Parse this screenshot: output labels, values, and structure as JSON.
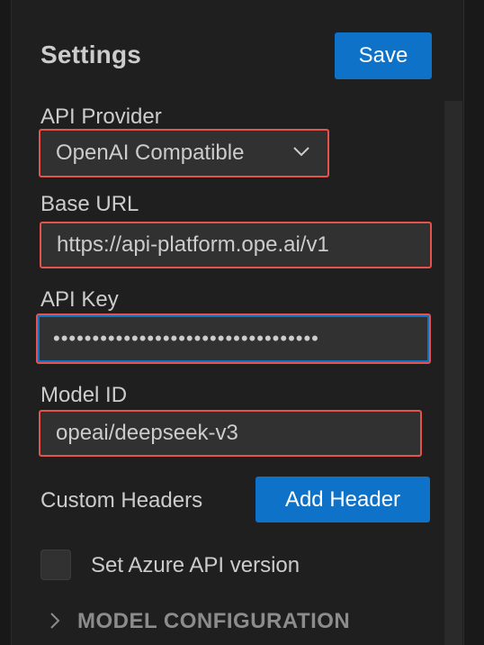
{
  "settings": {
    "title": "Settings",
    "save_label": "Save"
  },
  "api_provider": {
    "label": "API Provider",
    "selected": "OpenAI Compatible"
  },
  "base_url": {
    "label": "Base URL",
    "value": "https://api-platform.ope.ai/v1"
  },
  "api_key": {
    "label": "API Key",
    "value": "••••••••••••••••••••••••••••••••••"
  },
  "model_id": {
    "label": "Model ID",
    "value": "opeai/deepseek-v3"
  },
  "custom_headers": {
    "label": "Custom Headers",
    "button_label": "Add Header"
  },
  "azure": {
    "label": "Set Azure API version",
    "checked": false
  },
  "model_configuration": {
    "label": "MODEL CONFIGURATION"
  },
  "colors": {
    "accent": "#0e72c8",
    "highlight_border": "#e5534b",
    "background": "#1f1f1f"
  },
  "icons": {
    "select_chevron": "chevron-down-icon",
    "section_chevron": "chevron-right-icon"
  }
}
